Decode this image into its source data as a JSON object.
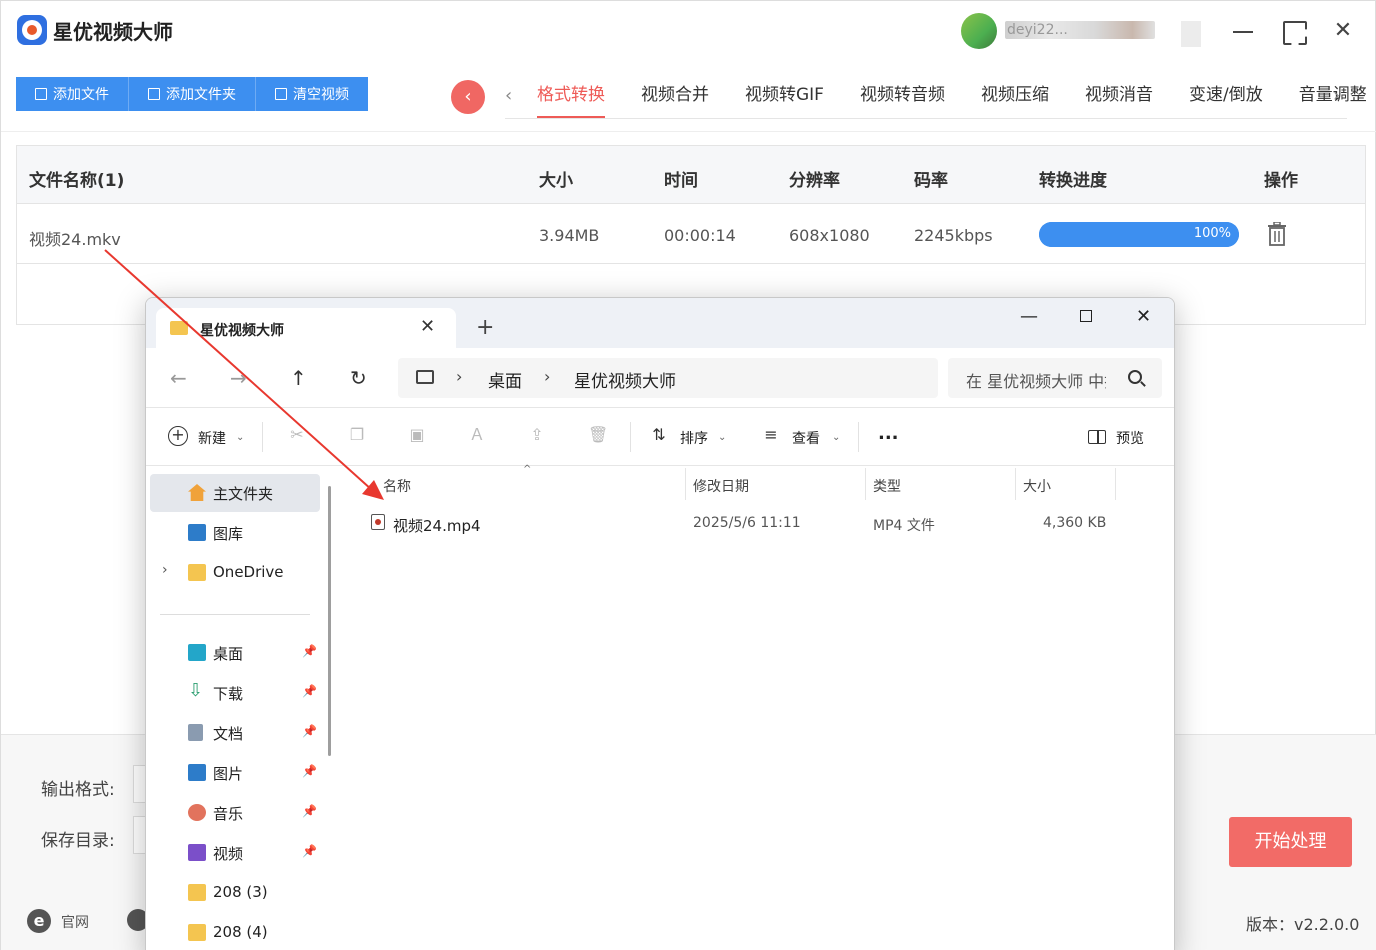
{
  "app": {
    "title": "星优视频大师",
    "user_name": "deyi22...",
    "buttons": {
      "add_file": "添加文件",
      "add_folder": "添加文件夹",
      "clear": "清空视频"
    },
    "tabs": [
      "格式转换",
      "视频合并",
      "视频转GIF",
      "视频转音频",
      "视频压缩",
      "视频消音",
      "变速/倒放",
      "音量调整"
    ],
    "active_tab": "格式转换",
    "table": {
      "headers": {
        "name": "文件名称(1)",
        "size": "大小",
        "time": "时间",
        "resolution": "分辨率",
        "bitrate": "码率",
        "progress": "转换进度",
        "action": "操作"
      },
      "rows": [
        {
          "name": "视频24.mkv",
          "size": "3.94MB",
          "time": "00:00:14",
          "resolution": "608x1080",
          "bitrate": "2245kbps",
          "progress_text": "100%",
          "progress_fraction": 1.0
        }
      ]
    },
    "bottom": {
      "output_format_label": "输出格式:",
      "save_dir_label": "保存目录:",
      "start_button": "开始处理",
      "official_site": "官网",
      "version": "版本：v2.2.0.0"
    },
    "colors": {
      "primary_blue": "#3d8ff0",
      "accent_red": "#ee5b57",
      "start_button": "#f26b67"
    }
  },
  "explorer": {
    "tab_title": "星优视频大师",
    "breadcrumb": [
      "桌面",
      "星优视频大师"
    ],
    "search_placeholder": "在 星优视频大师 中搜索",
    "commands": {
      "new": "新建",
      "sort": "排序",
      "view": "查看",
      "more": "...",
      "preview": "预览"
    },
    "sidebar": [
      {
        "label": "主文件夹",
        "icon": "home-icon"
      },
      {
        "label": "图库",
        "icon": "gallery-icon"
      },
      {
        "label": "OneDrive",
        "icon": "folder-icon"
      },
      {
        "label": "桌面",
        "icon": "desktop-icon"
      },
      {
        "label": "下载",
        "icon": "download-icon"
      },
      {
        "label": "文档",
        "icon": "document-icon"
      },
      {
        "label": "图片",
        "icon": "pictures-icon"
      },
      {
        "label": "音乐",
        "icon": "music-icon"
      },
      {
        "label": "视频",
        "icon": "video-icon"
      },
      {
        "label": "208 (3)",
        "icon": "folder-icon"
      },
      {
        "label": "208 (4)",
        "icon": "folder-icon"
      }
    ],
    "columns": {
      "name": "名称",
      "modified": "修改日期",
      "type": "类型",
      "size": "大小"
    },
    "files": [
      {
        "name": "视频24.mp4",
        "modified": "2025/5/6 11:11",
        "type": "MP4 文件",
        "size": "4,360 KB"
      }
    ]
  }
}
